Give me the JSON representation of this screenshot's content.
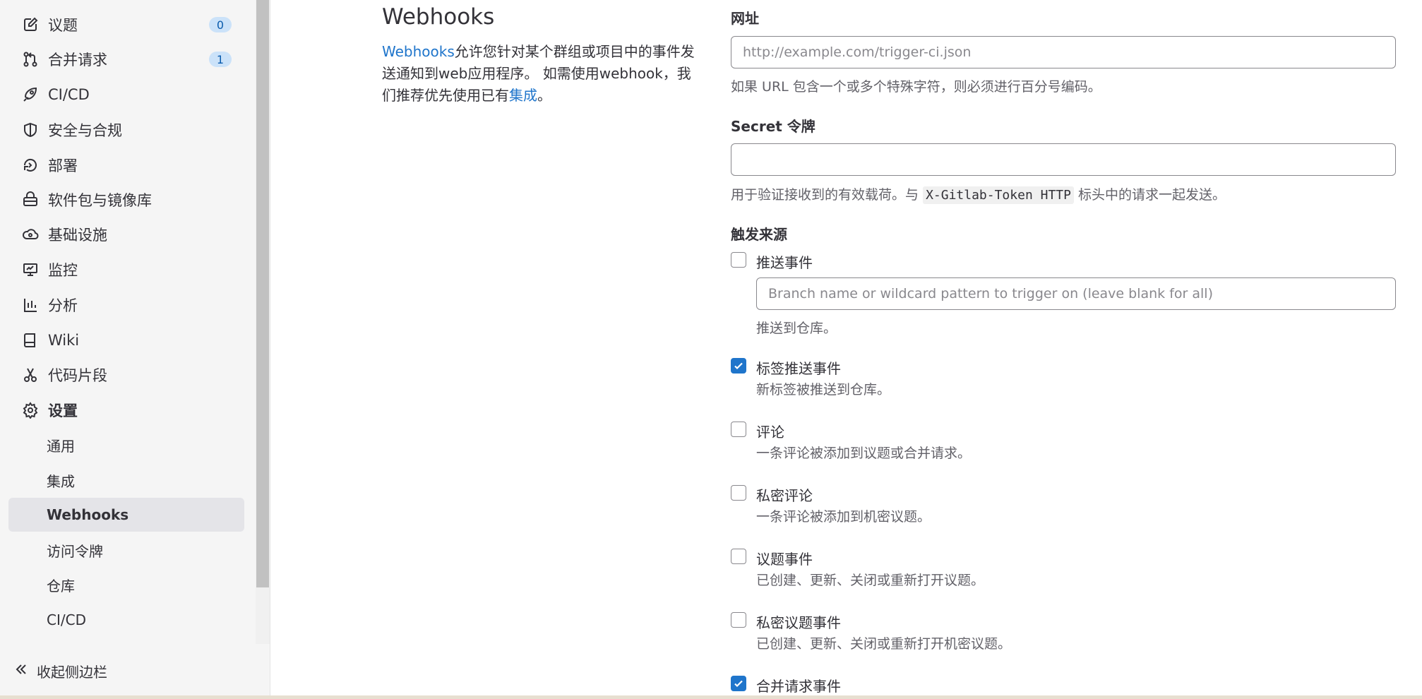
{
  "sidebar": {
    "items": [
      {
        "label": "议题",
        "icon": "issues-icon",
        "badge": "0"
      },
      {
        "label": "合并请求",
        "icon": "merge-request-icon",
        "badge": "1"
      },
      {
        "label": "CI/CD",
        "icon": "rocket-icon"
      },
      {
        "label": "安全与合规",
        "icon": "shield-icon"
      },
      {
        "label": "部署",
        "icon": "deployments-icon"
      },
      {
        "label": "软件包与镜像库",
        "icon": "package-icon"
      },
      {
        "label": "基础设施",
        "icon": "cloud-gear-icon"
      },
      {
        "label": "监控",
        "icon": "monitor-icon"
      },
      {
        "label": "分析",
        "icon": "chart-icon"
      },
      {
        "label": "Wiki",
        "icon": "book-icon"
      },
      {
        "label": "代码片段",
        "icon": "snippet-icon"
      },
      {
        "label": "设置",
        "icon": "gear-icon"
      }
    ],
    "settings_sub": [
      "通用",
      "集成",
      "Webhooks",
      "访问令牌",
      "仓库",
      "CI/CD"
    ],
    "active_sub": "Webhooks",
    "collapse_label": "收起侧边栏"
  },
  "section": {
    "title": "Webhooks",
    "desc_link": "Webhooks",
    "desc_text": "允许您针对某个群组或项目中的事件发送通知到web应用程序。 如需使用webhook，我们推荐优先使用已有",
    "desc_link2": "集成",
    "desc_end": "。"
  },
  "form": {
    "url": {
      "label": "网址",
      "placeholder": "http://example.com/trigger-ci.json",
      "value": "",
      "help": "如果 URL 包含一个或多个特殊字符，则必须进行百分号编码。"
    },
    "secret": {
      "label": "Secret 令牌",
      "value": "",
      "help_pre": "用于验证接收到的有效载荷。与",
      "help_code": "X-Gitlab-Token HTTP",
      "help_post": "标头中的请求一起发送。"
    },
    "triggers_label": "触发来源",
    "triggers": [
      {
        "label": "推送事件",
        "checked": false,
        "help": "推送到仓库。",
        "branch_placeholder": "Branch name or wildcard pattern to trigger on (leave blank for all)"
      },
      {
        "label": "标签推送事件",
        "checked": true,
        "help": "新标签被推送到仓库。"
      },
      {
        "label": "评论",
        "checked": false,
        "help": "一条评论被添加到议题或合并请求。"
      },
      {
        "label": "私密评论",
        "checked": false,
        "help": "一条评论被添加到机密议题。"
      },
      {
        "label": "议题事件",
        "checked": false,
        "help": "已创建、更新、关闭或重新打开议题。"
      },
      {
        "label": "私密议题事件",
        "checked": false,
        "help": "已创建、更新、关闭或重新打开机密议题。"
      },
      {
        "label": "合并请求事件",
        "checked": true,
        "help": ""
      }
    ]
  },
  "colors": {
    "accent": "#1f75cb",
    "badge_bg": "#cbe2f9",
    "sidebar_bg": "#f5f5f5",
    "active_bg": "#e4e4e8"
  }
}
